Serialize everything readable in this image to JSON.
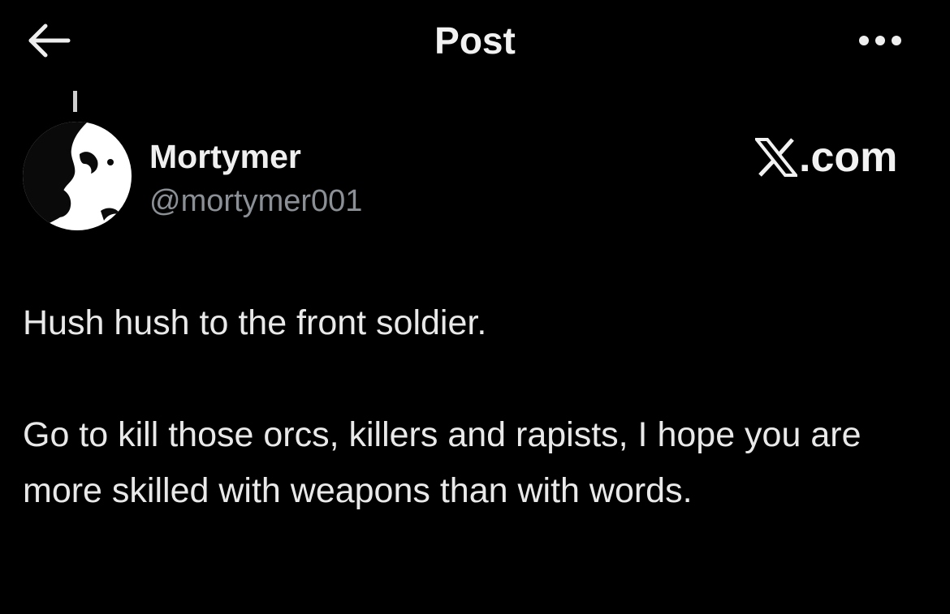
{
  "header": {
    "title": "Post",
    "back_icon": "arrow-left-icon",
    "more_icon": "more-horizontal-icon"
  },
  "post": {
    "author": {
      "display_name": "Mortymer",
      "handle": "@mortymer001"
    },
    "brand_watermark": {
      "text": ".com",
      "logo": "x-logo-icon"
    },
    "paragraphs": [
      "Hush hush to the front soldier.",
      "Go to kill those orcs, killers and rapists, I hope you are more skilled with weapons than with words."
    ]
  },
  "colors": {
    "background": "#000000",
    "text_primary": "#e9e9e9",
    "text_secondary": "#8b9096"
  }
}
